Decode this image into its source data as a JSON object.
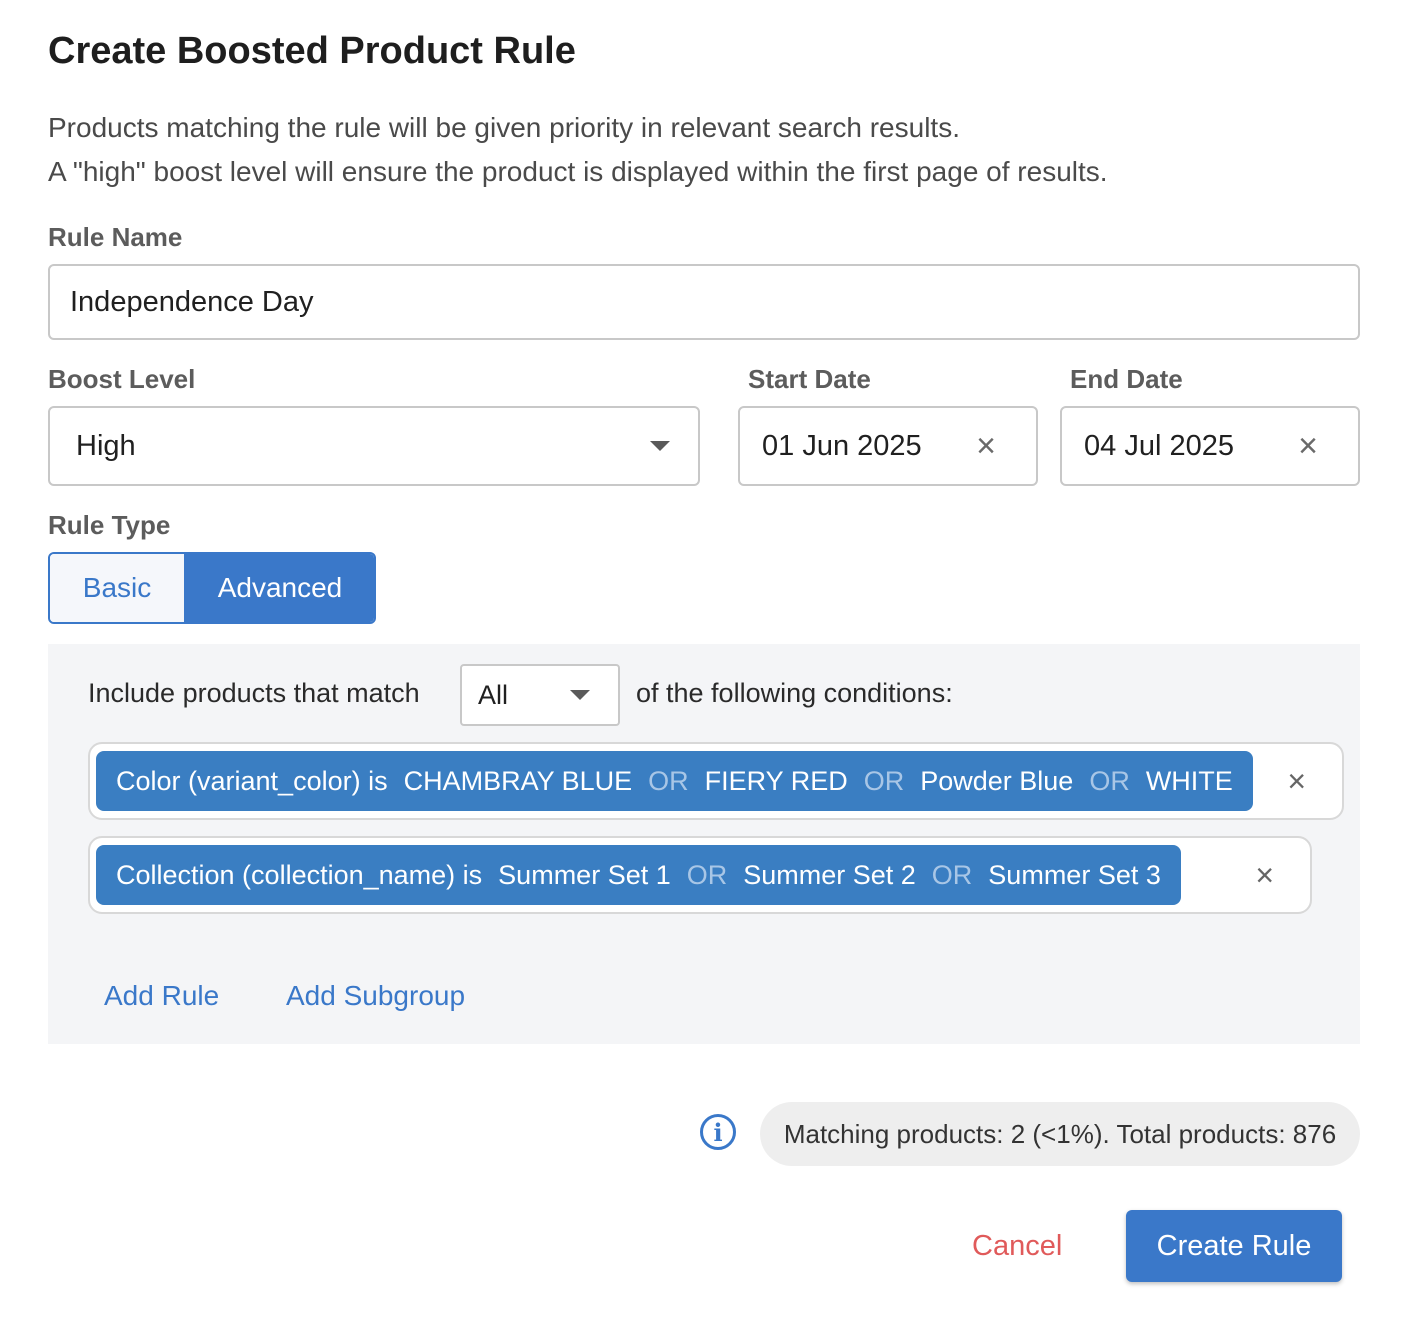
{
  "dialog": {
    "title": "Create Boosted Product Rule",
    "description_line1": "Products matching the rule will be given priority in relevant search results.",
    "description_line2": "A \"high\" boost level will ensure the product is displayed within the first page of results."
  },
  "rule_name": {
    "label": "Rule Name",
    "value": "Independence Day"
  },
  "boost_level": {
    "label": "Boost Level",
    "value": "High"
  },
  "start_date": {
    "label": "Start Date",
    "value": "01 Jun 2025"
  },
  "end_date": {
    "label": "End Date",
    "value": "04 Jul 2025"
  },
  "rule_type": {
    "label": "Rule Type",
    "options": [
      "Basic",
      "Advanced"
    ],
    "selected": "Advanced"
  },
  "conditions": {
    "prefix": "Include products that match",
    "match_mode": "All",
    "suffix": "of the following conditions:",
    "or_label": "OR",
    "rules": [
      {
        "field": "Color (variant_color) is",
        "values": [
          "CHAMBRAY BLUE",
          "FIERY RED",
          "Powder Blue",
          "WHITE"
        ]
      },
      {
        "field": "Collection (collection_name) is",
        "values": [
          "Summer Set 1",
          "Summer Set 2",
          "Summer Set 3"
        ]
      }
    ],
    "add_rule": "Add Rule",
    "add_subgroup": "Add Subgroup"
  },
  "matching": {
    "text": "Matching products: 2 (<1%). Total products: 876"
  },
  "actions": {
    "cancel": "Cancel",
    "create": "Create Rule"
  },
  "colors": {
    "primary": "#3a78c9",
    "chip": "#3a7ec2",
    "danger": "#e05a5a",
    "panel": "#f4f5f7"
  }
}
